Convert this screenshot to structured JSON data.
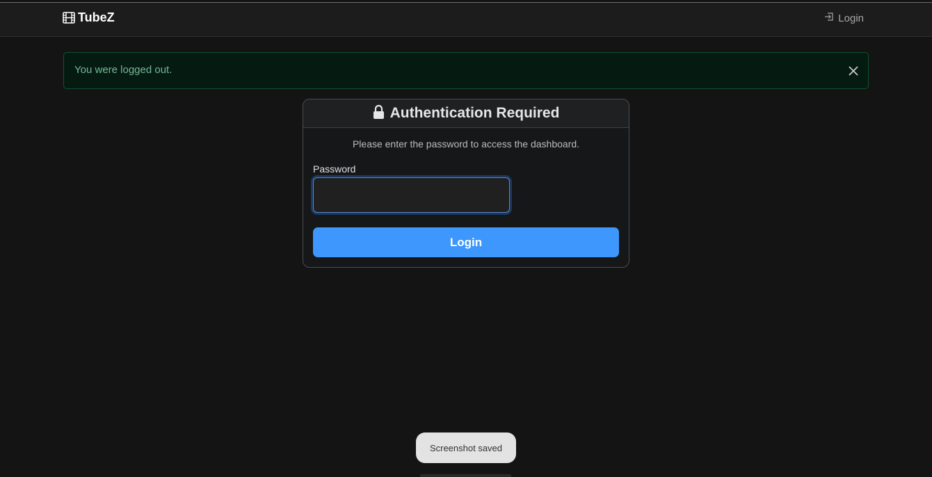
{
  "navbar": {
    "brand": "TubeZ",
    "brand_icon": "film-icon",
    "login_label": "Login",
    "login_icon": "box-arrow-in-right-icon"
  },
  "alert": {
    "message": "You were logged out.",
    "close_icon": "close-icon",
    "color": "#75b798"
  },
  "auth_card": {
    "title": "Authentication Required",
    "title_icon": "lock-icon",
    "description": "Please enter the password to access the dashboard.",
    "password_label": "Password",
    "password_value": "",
    "button_label": "Login",
    "button_color": "#3d97fc"
  },
  "toast": {
    "message": "Screenshot saved"
  }
}
